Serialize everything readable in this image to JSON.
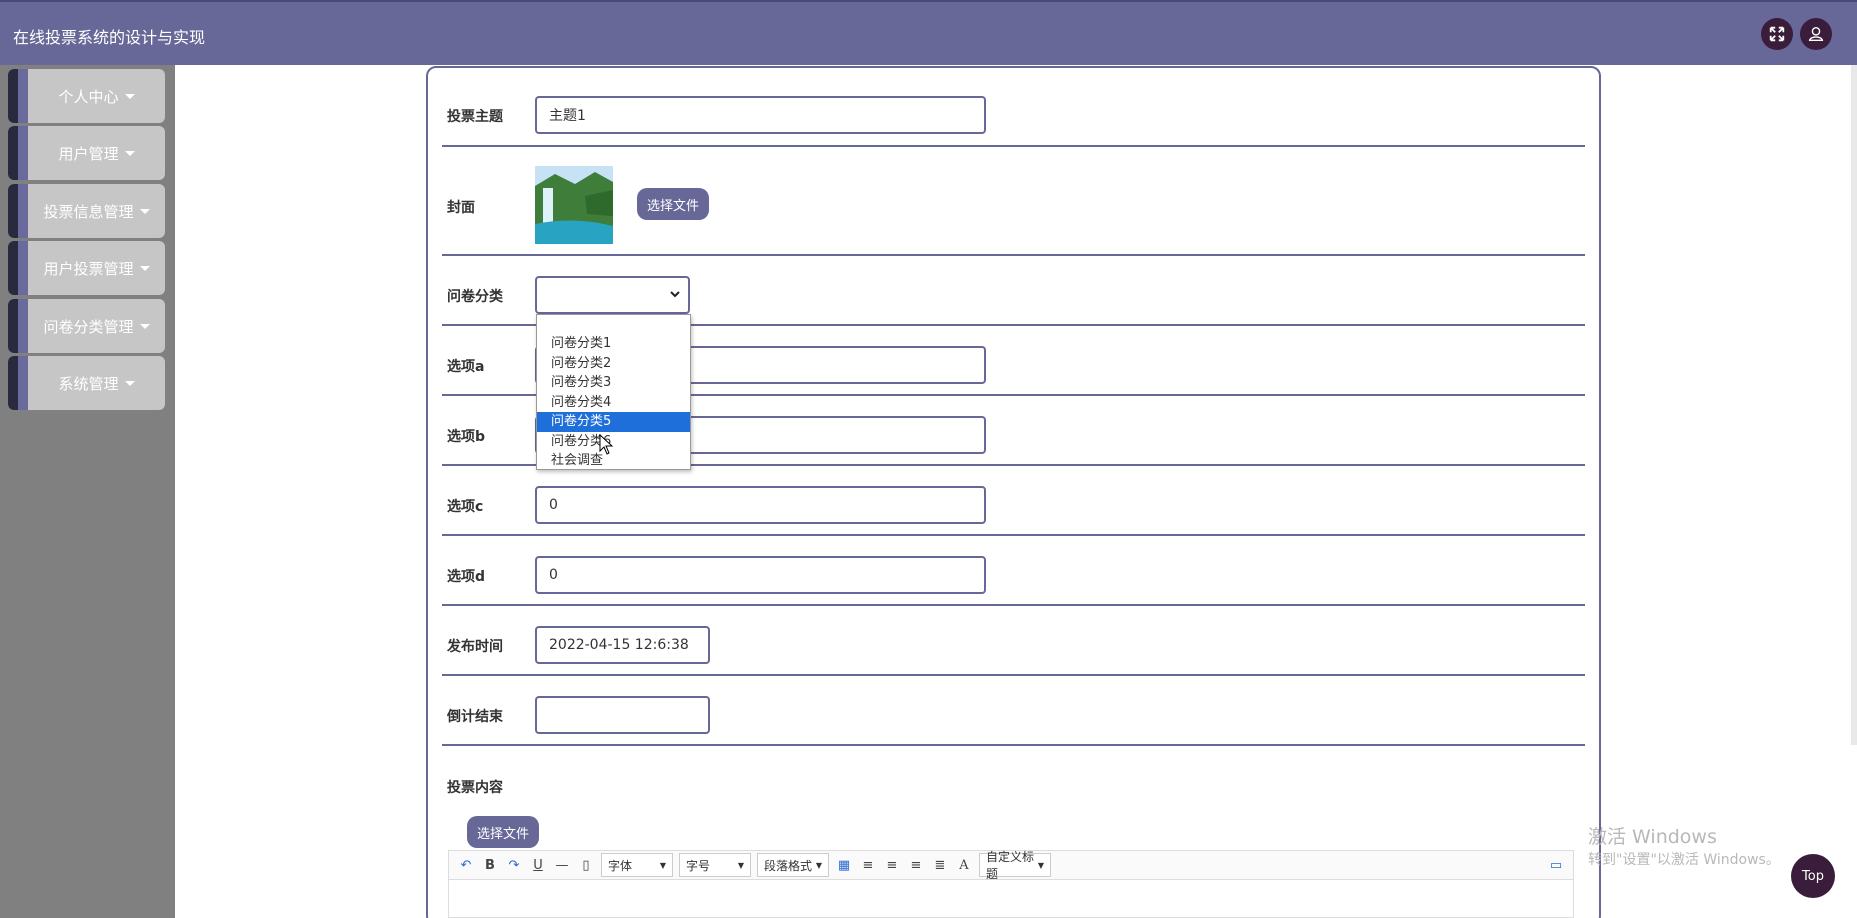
{
  "header": {
    "title": "在线投票系统的设计与实现",
    "fullscreen_icon": "expand-icon",
    "user_icon": "user-icon"
  },
  "sidebar": {
    "items": [
      {
        "label": "个人中心"
      },
      {
        "label": "用户管理"
      },
      {
        "label": "投票信息管理"
      },
      {
        "label": "用户投票管理"
      },
      {
        "label": "问卷分类管理"
      },
      {
        "label": "系统管理"
      }
    ]
  },
  "form": {
    "topic": {
      "label": "投票主题",
      "value": "主题1"
    },
    "cover": {
      "label": "封面",
      "button": "选择文件"
    },
    "category": {
      "label": "问卷分类",
      "value": "",
      "options": [
        "",
        "问卷分类1",
        "问卷分类2",
        "问卷分类3",
        "问卷分类4",
        "问卷分类5",
        "问卷分类6",
        "社会调查"
      ],
      "highlighted": "问卷分类5"
    },
    "option_a": {
      "label": "选项a",
      "value": ""
    },
    "option_b": {
      "label": "选项b",
      "value": ""
    },
    "option_c": {
      "label": "选项c",
      "value": "0"
    },
    "option_d": {
      "label": "选项d",
      "value": "0"
    },
    "publish_time": {
      "label": "发布时间",
      "value": "2022-04-15 12:6:38"
    },
    "countdown": {
      "label": "倒计结束",
      "value": ""
    },
    "content": {
      "label": "投票内容",
      "button": "选择文件"
    }
  },
  "editor_toolbar": {
    "font": "字体",
    "size": "字号",
    "paragraph": "段落格式",
    "heading": "自定义标题",
    "bold": "B",
    "underline": "U",
    "fontcolor": "A"
  },
  "watermark": {
    "line1": "激活 Windows",
    "line2": "转到\"设置\"以激活 Windows。"
  },
  "top_button": "Top",
  "colors": {
    "primary": "#686898",
    "sidebar_bg": "#808080",
    "sidebar_item": "#c6c6c6",
    "dark_button": "#3a1d3a",
    "selected_option": "#1e6fd9"
  }
}
